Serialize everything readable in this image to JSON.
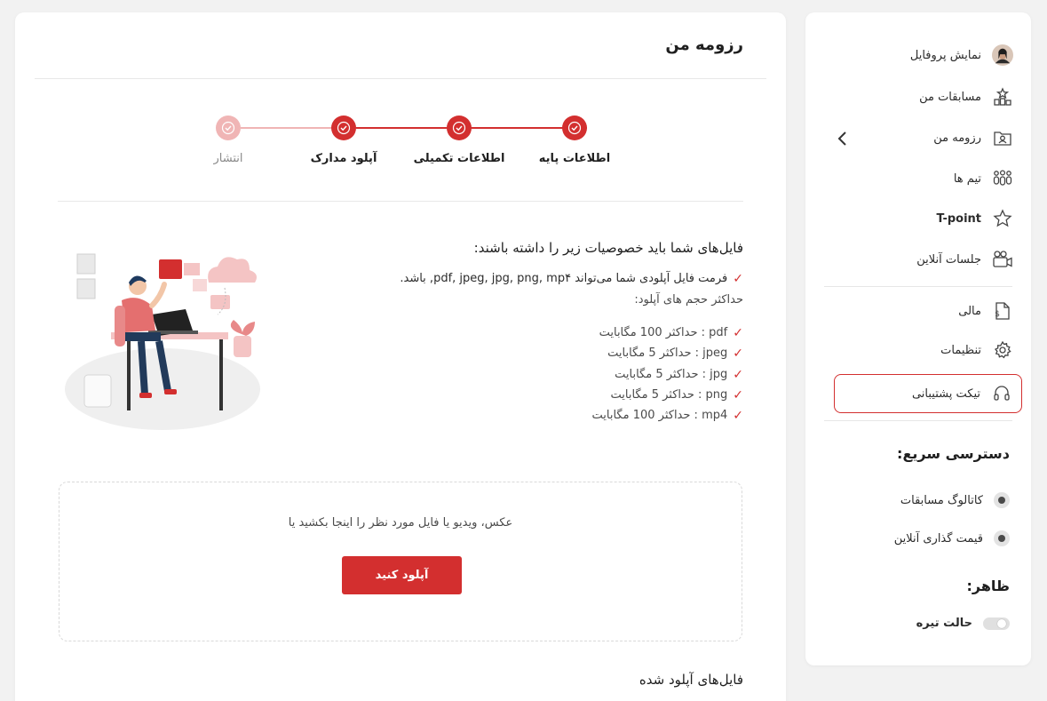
{
  "sidebar": {
    "items": [
      {
        "label": "نمایش پروفایل",
        "icon": "avatar"
      },
      {
        "label": "مسابقات من",
        "icon": "competition-icon"
      },
      {
        "label": "رزومه من",
        "icon": "resume-icon"
      },
      {
        "label": "تیم ها",
        "icon": "team-icon"
      },
      {
        "label": "T-point",
        "icon": "star-icon"
      },
      {
        "label": "جلسات آنلاین",
        "icon": "video-icon"
      },
      {
        "label": "مالی",
        "icon": "finance-icon"
      },
      {
        "label": "تنظیمات",
        "icon": "gear-icon"
      },
      {
        "label": "تیکت پشتیبانی",
        "icon": "headset-icon",
        "active": true
      }
    ],
    "quick_access": {
      "title": "دسترسی سریع:",
      "items": [
        "کاتالوگ مسابقات",
        "قیمت گذاری آنلاین"
      ]
    },
    "appearance": {
      "title": "ظاهر:",
      "dark_mode_label": "حالت تیره",
      "dark_mode_on": false
    }
  },
  "main": {
    "title": "رزومه من",
    "steps": [
      {
        "label": "اطلاعات پایه",
        "state": "done"
      },
      {
        "label": "اطلاعات تکمیلی",
        "state": "done"
      },
      {
        "label": "آپلود مدارک",
        "state": "current"
      },
      {
        "label": "انتشار",
        "state": "pending"
      }
    ],
    "requirements": {
      "heading": "فایل‌های شما باید خصوصیات زیر را داشته باشند:",
      "format_line": "فرمت فایل آپلودی شما می‌تواند pdf, jpeg, jpg, png, mp۴, باشد.",
      "size_heading": "حداکثر حجم های آپلود:",
      "limits": [
        "pdf : حداکثر 100 مگابایت",
        "jpeg : حداکثر 5 مگابایت",
        "jpg : حداکثر 5 مگابایت",
        "png : حداکثر 5 مگابایت",
        "mp4 : حداکثر 100 مگابایت"
      ]
    },
    "dropzone": {
      "text": "عکس، ویدیو یا فایل مورد نظر را اینجا بکشید یا",
      "button_label": "آپلود کنید"
    },
    "uploaded_title": "فایل‌های آپلود شده"
  },
  "colors": {
    "accent": "#d32f2f",
    "accent_light": "#f0b5b5",
    "background": "#f2f2f2",
    "card": "#ffffff"
  }
}
